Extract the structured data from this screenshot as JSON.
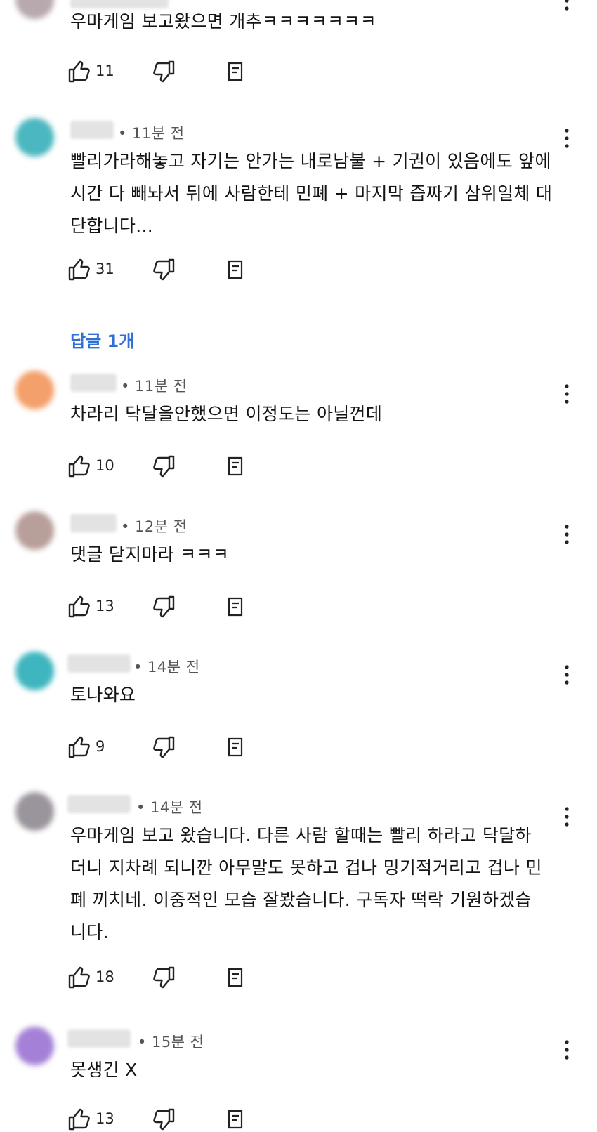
{
  "comments": [
    {
      "time": "",
      "text": "우마게임 보고왔으면 개추ㅋㅋㅋㅋㅋㅋㅋ",
      "likes": "11",
      "avatar_color": "#b7a9ad"
    },
    {
      "time": "• 11분 전",
      "text": "빨리가라해놓고 자기는 안가는 내로남불 + 기권이 있음에도 앞에 시간 다 빼놔서 뒤에 사람한테 민폐 + 마지막 즙짜기 삼위일체 대단합니다...",
      "likes": "31",
      "avatar_color": "#4bb7c0"
    },
    {
      "time": "• 11분 전",
      "text": "차라리 닥달을안했으면 이정도는 아닐껀데",
      "likes": "10",
      "avatar_color": "#f3a06a"
    },
    {
      "time": "• 12분 전",
      "text": "댓글 닫지마라 ㅋㅋㅋ",
      "likes": "13",
      "avatar_color": "#b89f9a"
    },
    {
      "time": "• 14분 전",
      "text": "토나와요",
      "likes": "9",
      "avatar_color": "#3fb5bf"
    },
    {
      "time": "• 14분 전",
      "text": "우마게임 보고 왔습니다. 다른 사람 할때는 빨리 하라고 닥달하더니 지차례 되니깐 아무말도 못하고 겁나 밍기적거리고 겁나 민폐 끼치네. 이중적인 모습 잘봤습니다. 구독자 떡락 기원하겠습니다.",
      "likes": "18",
      "avatar_color": "#9a959c"
    },
    {
      "time": "• 15분 전",
      "text": "못생긴 X",
      "likes": "13",
      "avatar_color": "#a481d6"
    }
  ],
  "replies_link": "답글 1개"
}
